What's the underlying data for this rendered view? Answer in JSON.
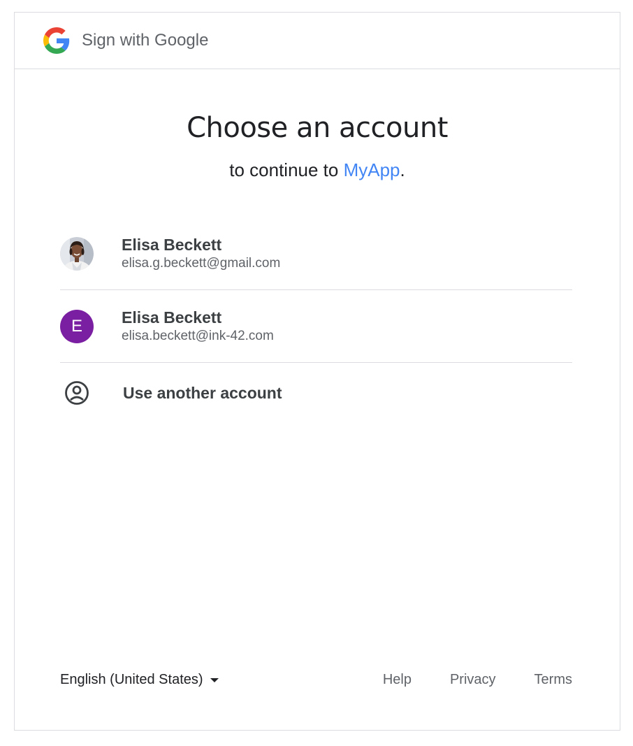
{
  "header": {
    "title": "Sign with Google",
    "logo_icon": "google-g-icon"
  },
  "main": {
    "title": "Choose an account",
    "subtitle_prefix": "to continue to ",
    "app_name": "MyApp",
    "subtitle_suffix": "."
  },
  "accounts": [
    {
      "name": "Elisa Beckett",
      "email": "elisa.g.beckett@gmail.com",
      "avatar": "profile-photo"
    },
    {
      "name": "Elisa Beckett",
      "email": "elisa.beckett@ink-42.com",
      "avatar_letter": "E",
      "avatar_color": "#7b1fa2"
    }
  ],
  "another_account": {
    "label": "Use another account",
    "icon": "account-circle-icon"
  },
  "footer": {
    "language": "English (United States)",
    "help": "Help",
    "privacy": "Privacy",
    "terms": "Terms"
  },
  "colors": {
    "link_blue": "#4285f4",
    "divider": "#dadce0"
  }
}
